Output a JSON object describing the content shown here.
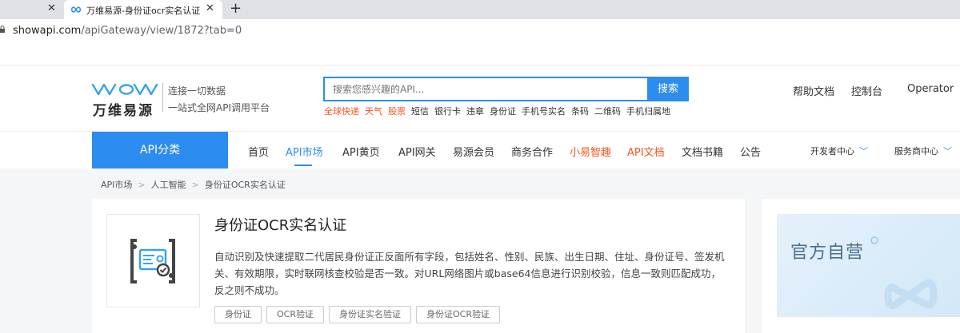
{
  "browser": {
    "tabs": [
      {
        "title": "",
        "close": "✕"
      },
      {
        "title": "万维易源-身份证ocr实名认证",
        "close": "✕"
      }
    ],
    "new_tab": "+",
    "url_host": "showapi.com",
    "url_path": "/apiGateway/view/1872?tab=0"
  },
  "header": {
    "brand": "万维易源",
    "slogan1": "连接一切数据",
    "slogan2": "一站式全网API调用平台",
    "search": {
      "placeholder": "搜索您感兴趣的API...",
      "button": "搜索"
    },
    "hot_keywords": [
      {
        "label": "全球快递",
        "red": true
      },
      {
        "label": "天气",
        "red": true
      },
      {
        "label": "股票",
        "red": true
      },
      {
        "label": "短信",
        "red": false
      },
      {
        "label": "银行卡",
        "red": false
      },
      {
        "label": "违章",
        "red": false
      },
      {
        "label": "身份证",
        "red": false
      },
      {
        "label": "手机号实名",
        "red": false
      },
      {
        "label": "条码",
        "red": false
      },
      {
        "label": "二维码",
        "red": false
      },
      {
        "label": "手机归属地",
        "red": false
      }
    ],
    "docs": "帮助文档",
    "console": "控制台",
    "user": "Operator"
  },
  "nav": {
    "category": "API分类",
    "items": [
      {
        "label": "首页",
        "style": "normal"
      },
      {
        "label": "API市场",
        "style": "active"
      },
      {
        "label": "API黄页",
        "style": "normal"
      },
      {
        "label": "API网关",
        "style": "normal"
      },
      {
        "label": "易源会员",
        "style": "normal"
      },
      {
        "label": "商务合作",
        "style": "normal"
      },
      {
        "label": "小易智趣",
        "style": "orange"
      },
      {
        "label": "API文档",
        "style": "orange"
      },
      {
        "label": "文档书籍",
        "style": "normal"
      },
      {
        "label": "公告",
        "style": "normal"
      }
    ],
    "dev_center": "开发者中心",
    "provider_center": "服务商中心"
  },
  "breadcrumb": [
    "API市场",
    "人工智能",
    "身份证OCR实名认证"
  ],
  "breadcrumb_sep": ">",
  "product": {
    "title": "身份证OCR实名认证",
    "description": "自动识别及快速提取二代居民身份证正反面所有字段，包括姓名、性别、民族、出生日期、住址、身份证号、签发机关、有效期限，实时联网核查校验是否一致。对URL网络图片或base64信息进行识别校验，信息一致则匹配成功，反之则不成功。",
    "tags": [
      "身份证",
      "OCR验证",
      "身份证实名验证",
      "身份证OCR验证"
    ],
    "icon": "id-card-icon"
  },
  "side": {
    "official": "官方自营"
  },
  "colors": {
    "primary": "#2d8cf0",
    "orange": "#f5551d",
    "bg": "#f5f6f8"
  }
}
